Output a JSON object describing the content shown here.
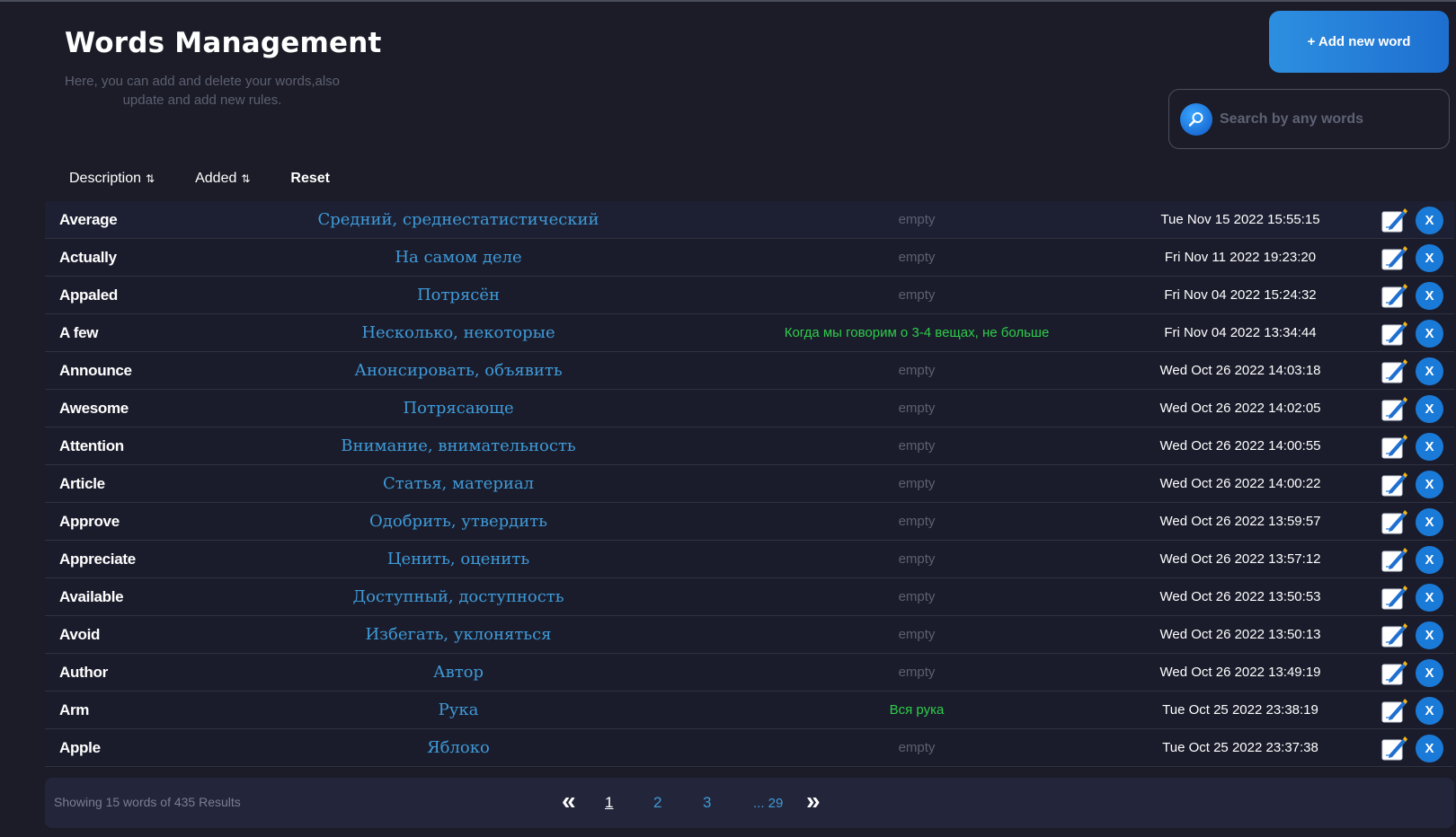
{
  "header": {
    "title": "Words Management",
    "subtitle": "Here, you can add and delete your words,also update and add new rules."
  },
  "actions": {
    "add_label": "+ Add new word"
  },
  "search": {
    "placeholder": "Search by any words"
  },
  "sort": {
    "description_label": "Description",
    "added_label": "Added",
    "sort_icon": "sort-arrows",
    "reset_label": "Reset"
  },
  "words": [
    {
      "word": "Average",
      "translation": "Средний, среднестатистический",
      "rule": "empty",
      "added": "Tue Nov 15 2022 15:55:15"
    },
    {
      "word": "Actually",
      "translation": "На самом деле",
      "rule": "empty",
      "added": "Fri Nov 11 2022 19:23:20"
    },
    {
      "word": "Appaled",
      "translation": "Потрясён",
      "rule": "empty",
      "added": "Fri Nov 04 2022 15:24:32"
    },
    {
      "word": "A few",
      "translation": "Несколько, некоторые",
      "rule": "Когда мы говорим о 3-4 вещах, не больше",
      "added": "Fri Nov 04 2022 13:34:44"
    },
    {
      "word": "Announce",
      "translation": "Анонсировать, объявить",
      "rule": "empty",
      "added": "Wed Oct 26 2022 14:03:18"
    },
    {
      "word": "Awesome",
      "translation": "Потрясающе",
      "rule": "empty",
      "added": "Wed Oct 26 2022 14:02:05"
    },
    {
      "word": "Attention",
      "translation": "Внимание, внимательность",
      "rule": "empty",
      "added": "Wed Oct 26 2022 14:00:55"
    },
    {
      "word": "Article",
      "translation": "Статья, материал",
      "rule": "empty",
      "added": "Wed Oct 26 2022 14:00:22"
    },
    {
      "word": "Approve",
      "translation": "Одобрить, утвердить",
      "rule": "empty",
      "added": "Wed Oct 26 2022 13:59:57"
    },
    {
      "word": "Appreciate",
      "translation": "Ценить, оценить",
      "rule": "empty",
      "added": "Wed Oct 26 2022 13:57:12"
    },
    {
      "word": "Available",
      "translation": "Доступный, доступность",
      "rule": "empty",
      "added": "Wed Oct 26 2022 13:50:53"
    },
    {
      "word": "Avoid",
      "translation": "Избегать, уклоняться",
      "rule": "empty",
      "added": "Wed Oct 26 2022 13:50:13"
    },
    {
      "word": "Author",
      "translation": "Автор",
      "rule": "empty",
      "added": "Wed Oct 26 2022 13:49:19"
    },
    {
      "word": "Arm",
      "translation": "Рука",
      "rule": "Вся рука",
      "added": "Tue Oct 25 2022 23:38:19"
    },
    {
      "word": "Apple",
      "translation": "Яблоко",
      "rule": "empty",
      "added": "Tue Oct 25 2022 23:37:38"
    }
  ],
  "row_actions": {
    "edit_icon": "edit-icon",
    "delete_label": "X"
  },
  "footer": {
    "showing_text": "Showing 15 words of 435 Results"
  },
  "pagination": {
    "prev_label": "«",
    "next_label": "»",
    "pages": [
      "1",
      "2",
      "3"
    ],
    "current": "1",
    "last_label": "... 29"
  },
  "colors": {
    "background": "#1b1c27",
    "accent": "#1a7ad8",
    "translation": "#3f9ad8",
    "rule_filled": "#2ecc4a",
    "rule_empty": "#5d6072"
  }
}
